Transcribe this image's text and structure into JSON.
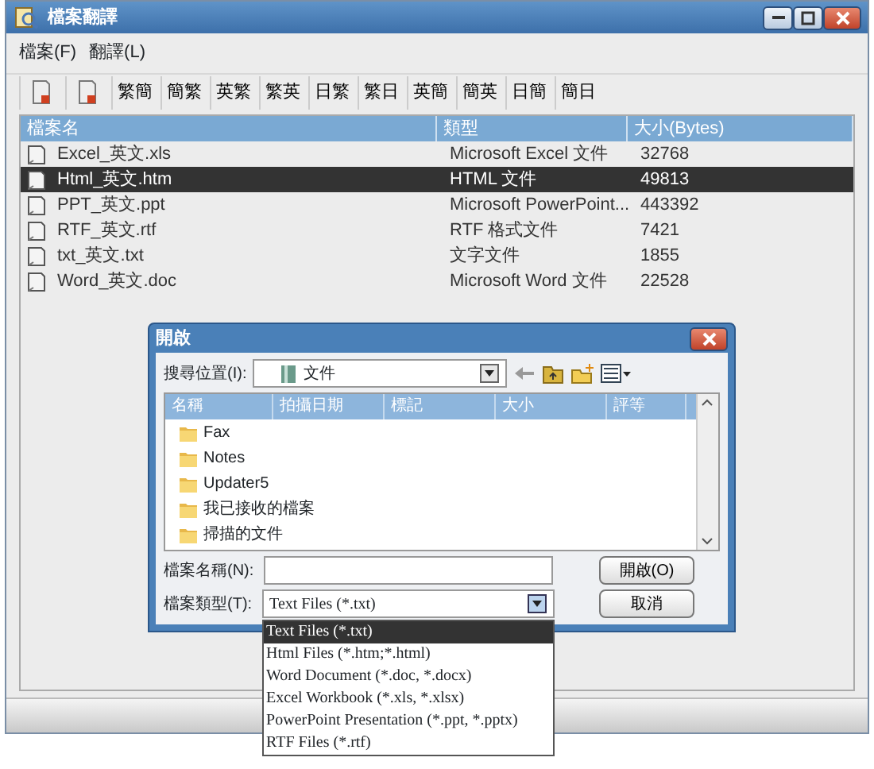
{
  "window": {
    "title": "檔案翻譯"
  },
  "menu": [
    "檔案(F)",
    "翻譯(L)"
  ],
  "toolbar": [
    {
      "kind": "icon"
    },
    {
      "kind": "icon"
    },
    {
      "kind": "text",
      "label": "繁簡"
    },
    {
      "kind": "text",
      "label": "簡繁"
    },
    {
      "kind": "text",
      "label": "英繁"
    },
    {
      "kind": "text",
      "label": "繁英"
    },
    {
      "kind": "text",
      "label": "日繁"
    },
    {
      "kind": "text",
      "label": "繁日"
    },
    {
      "kind": "text",
      "label": "英簡"
    },
    {
      "kind": "text",
      "label": "簡英"
    },
    {
      "kind": "text",
      "label": "日簡"
    },
    {
      "kind": "text",
      "label": "簡日"
    }
  ],
  "table": {
    "columns": [
      "檔案名",
      "類型",
      "大小(Bytes)"
    ],
    "rows": [
      {
        "name": "Excel_英文.xls",
        "type": "Microsoft Excel 文件",
        "size": "32768",
        "selected": false
      },
      {
        "name": "Html_英文.htm",
        "type": "HTML 文件",
        "size": "49813",
        "selected": true
      },
      {
        "name": "PPT_英文.ppt",
        "type": "Microsoft PowerPoint...",
        "size": "443392",
        "selected": false
      },
      {
        "name": "RTF_英文.rtf",
        "type": "RTF 格式文件",
        "size": "7421",
        "selected": false
      },
      {
        "name": "txt_英文.txt",
        "type": "文字文件",
        "size": "1855",
        "selected": false
      },
      {
        "name": "Word_英文.doc",
        "type": "Microsoft Word 文件",
        "size": "22528",
        "selected": false
      }
    ]
  },
  "dialog": {
    "title": "開啟",
    "look_in_label": "搜尋位置(I):",
    "look_in_value": "文件",
    "columns": [
      "名稱",
      "拍攝日期",
      "標記",
      "大小",
      "評等"
    ],
    "items": [
      "Fax",
      "Notes",
      "Updater5",
      "我已接收的檔案",
      "掃描的文件"
    ],
    "file_name_label": "檔案名稱(N):",
    "file_type_label": "檔案類型(T):",
    "file_type_value": "Text Files (*.txt)",
    "buttons": [
      "開啟(O)",
      "取消"
    ],
    "file_type_options": [
      {
        "label": "Text Files (*.txt)",
        "selected": true
      },
      {
        "label": "Html Files (*.htm;*.html)",
        "selected": false
      },
      {
        "label": "Word Document (*.doc, *.docx)",
        "selected": false
      },
      {
        "label": "Excel Workbook (*.xls, *.xlsx)",
        "selected": false
      },
      {
        "label": "PowerPoint Presentation (*.ppt, *.pptx)",
        "selected": false
      },
      {
        "label": "RTF Files (*.rtf)",
        "selected": false
      }
    ]
  }
}
